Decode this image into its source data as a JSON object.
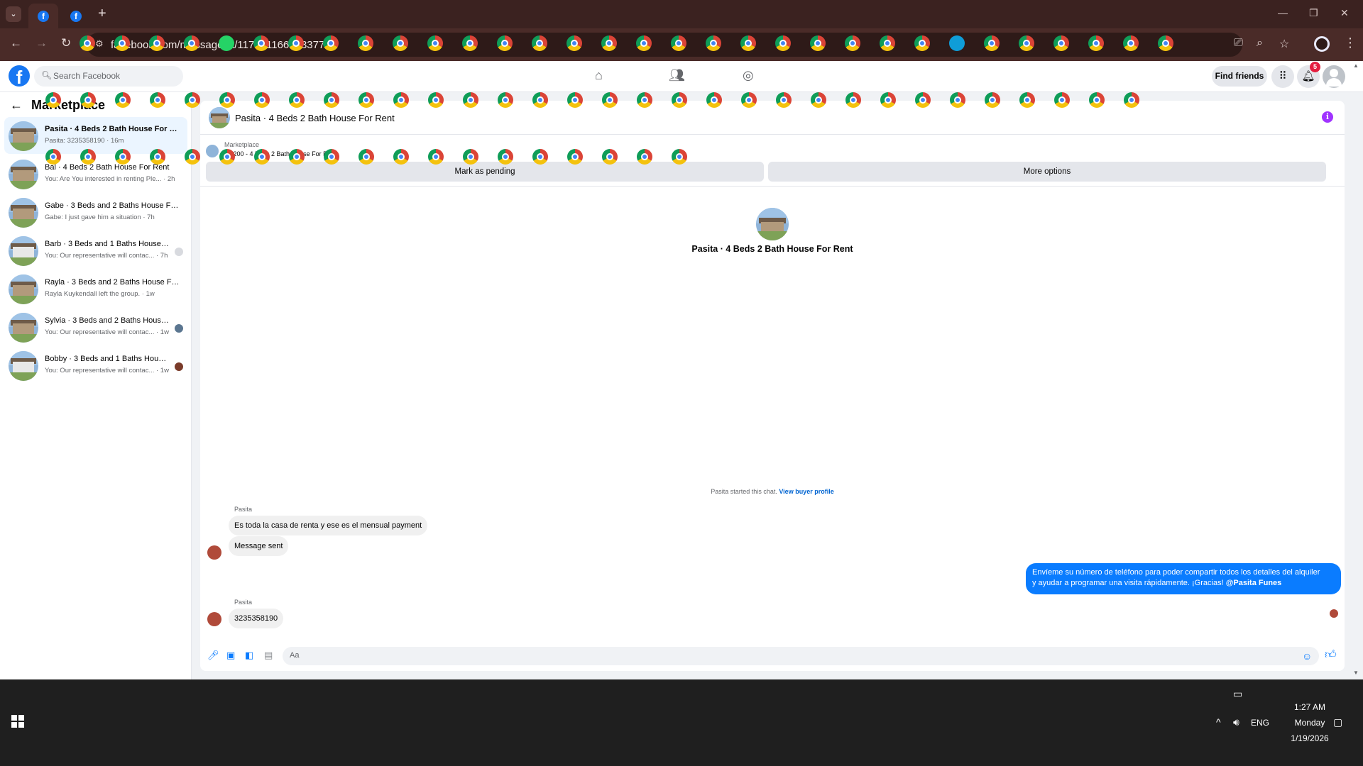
{
  "browser": {
    "url": "facebook.com/messages/t/1177911667833776",
    "new_tab_icon": "plus-icon"
  },
  "fb": {
    "logo": "f",
    "search_placeholder": "Search Facebook",
    "find_friends": "Find friends",
    "notification_count": "5"
  },
  "sidebar": {
    "title": "Marketplace",
    "conversations": [
      {
        "name": "Pasita · 4 Beds 2 Bath House For Rent",
        "preview": "Pasita: 3235358190 · 16m",
        "active": true
      },
      {
        "name": "Bal · 4 Beds 2 Bath House For Rent",
        "preview": "You: Are You interested in renting Ple... · 2h"
      },
      {
        "name": "Gabe · 3 Beds and 2 Baths House For Rent",
        "preview": "Gabe: I just gave him a situation · 7h"
      },
      {
        "name": "Barb · 3 Beds and 1 Baths House For Rent",
        "preview": "You: Our representative will contac... · 7h"
      },
      {
        "name": "Rayla · 3 Beds and 2 Baths House For Rent",
        "preview": "Rayla Kuykendall left the group. · 1w"
      },
      {
        "name": "Sylvia · 3 Beds and 2 Baths House For Rent",
        "preview": "You: Our representative will contac... · 1w"
      },
      {
        "name": "Bobby · 3 Beds and 1 Baths House For Rent",
        "preview": "You: Our representative will contac... · 1w"
      }
    ]
  },
  "chat": {
    "title": "Pasita · 4 Beds 2 Bath House For Rent",
    "marketplace_label": "Marketplace",
    "listing": "$1,200 - 4 Beds 2 Bath House For Rent",
    "mark_pending": "Mark as pending",
    "more_options": "More options",
    "center_title": "Pasita · 4 Beds 2 Bath House For Rent",
    "started_text": "Pasita started this chat.",
    "view_profile": "View buyer profile",
    "messages": [
      {
        "sender": "Pasita",
        "text": "Es toda la casa de renta y ese es el mensual payment"
      },
      {
        "text": "Message sent"
      },
      {
        "sender": "Pasita",
        "text": "3235358190"
      }
    ],
    "outgoing_line1": "Envíeme su número de teléfono para poder compartir todos los detalles del alquiler",
    "outgoing_line2": "y ayudar a programar una visita rápidamente. ¡Gracias!",
    "outgoing_mention": "@Pasita Funes",
    "composer_placeholder": "Aa"
  },
  "taskbar": {
    "language": "ENG",
    "time": "1:27 AM",
    "day": "Monday",
    "date": "1/19/2026"
  }
}
